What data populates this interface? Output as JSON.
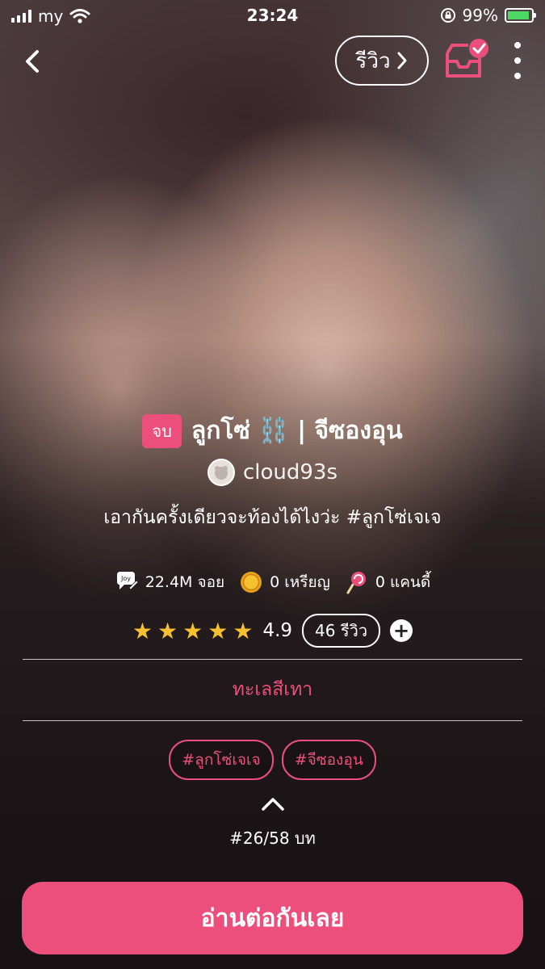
{
  "status_bar": {
    "carrier": "my",
    "time": "23:24",
    "battery": "99%"
  },
  "nav": {
    "review_label": "รีวิว"
  },
  "story": {
    "status_badge": "จบ",
    "title": "ลูกโซ่ ⛓️ | จีซองอุน",
    "author": "cloud93s",
    "description": "เอากันครั้งเดียวจะท้องได้ไงว่ะ #ลูกโซ่เจเจ"
  },
  "stats": {
    "views": "22.4M จอย",
    "coins": "0 เหรียญ",
    "candy": "0 แคนดี้"
  },
  "rating": {
    "stars": 5,
    "score": "4.9",
    "reviews": "46 รีวิว"
  },
  "category": "ทะเลสีเทา",
  "tags": [
    "#ลูกโซ่เจเจ",
    "#จีซองอุน"
  ],
  "chapter": "#26/58 บท",
  "cta": "อ่านต่อกันเลย",
  "colors": {
    "accent": "#ec4f7b",
    "star": "#f6c12e",
    "battery": "#4cd964"
  },
  "icons": [
    "back-chevron-icon",
    "chevron-right-icon",
    "inbox-icon",
    "more-icon",
    "joy-icon",
    "coin-icon",
    "candy-icon",
    "star-icon",
    "plus-icon",
    "chevron-up-icon"
  ]
}
